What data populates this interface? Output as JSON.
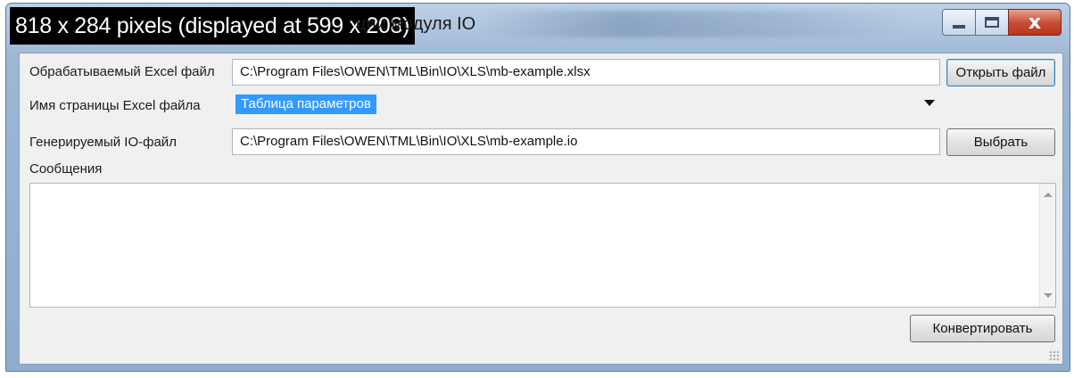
{
  "window": {
    "overlay_text": "818 x 284 pixels (displayed at 599 x 208)",
    "title_tail": "ции модуля IO",
    "controls": {
      "minimize": "minimize",
      "maximize": "maximize",
      "close": "x"
    }
  },
  "form": {
    "excel_file": {
      "label": "Обрабатываемый Excel файл",
      "value": "C:\\Program Files\\OWEN\\TML\\Bin\\IO\\XLS\\mb-example.xlsx",
      "button": "Открыть файл"
    },
    "sheet": {
      "label": "Имя страницы Excel файла",
      "selected": "Таблица параметров"
    },
    "io_file": {
      "label": "Генерируемый IO-файл",
      "value": "C:\\Program Files\\OWEN\\TML\\Bin\\IO\\XLS\\mb-example.io",
      "button": "Выбрать"
    },
    "messages": {
      "label": "Сообщения",
      "text": ""
    },
    "convert_button": "Конвертировать"
  },
  "colors": {
    "selection": "#3399ff",
    "close_button": "#c64a32",
    "frame": "#a9c1dc"
  }
}
